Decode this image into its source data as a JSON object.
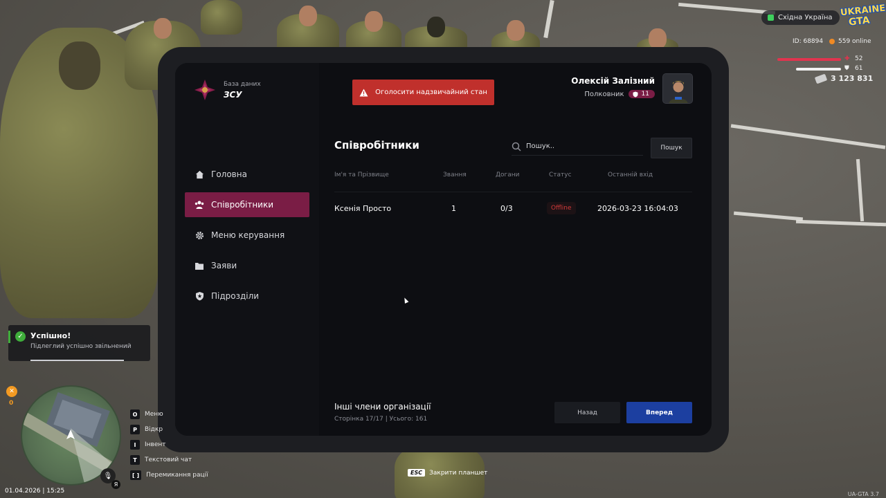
{
  "hud": {
    "region": "Східна Україна",
    "logo_line1": "UKRAINE",
    "logo_line2": "GTA",
    "player_id": "ID: 68894",
    "online": "559 online",
    "health": "52",
    "armor": "61",
    "health_level": 0.52,
    "armor_level": 0.61,
    "money": "3 123 831"
  },
  "org": {
    "subtitle": "База даних",
    "title": "ЗСУ"
  },
  "alarm_button": "Оголосити надзвичайний стан",
  "user": {
    "name": "Олексій Залізний",
    "rank": "Полковник",
    "rank_level": "11"
  },
  "sidebar": {
    "items": [
      {
        "label": "Головна",
        "icon": "home-icon"
      },
      {
        "label": "Співробітники",
        "icon": "people-icon",
        "active": true
      },
      {
        "label": "Меню керування",
        "icon": "gear-icon"
      },
      {
        "label": "Заяви",
        "icon": "folder-icon"
      },
      {
        "label": "Підрозділи",
        "icon": "shield-icon"
      }
    ]
  },
  "content": {
    "title": "Співробітники",
    "search_placeholder": "Пошук..",
    "search_button": "Пошук",
    "columns": [
      "Ім'я та Прізвище",
      "Звання",
      "Догани",
      "Статус",
      "Останній вхід"
    ],
    "rows": [
      {
        "name": "Ксенія Просто",
        "rank": "1",
        "reprimands": "0/3",
        "status": "Offline",
        "last_login": "2026-03-23 16:04:03"
      }
    ],
    "footer_title": "Інші члени організації",
    "footer_sub": "Сторінка 17/17 | Усього: 161",
    "back_button": "Назад",
    "next_button": "Вперед"
  },
  "toast": {
    "title": "Успішно!",
    "text": "Підлеглий успішно звільнений"
  },
  "hunger_value": "0",
  "mic_lang": "Я",
  "datetime": "01.04.2026 | 15:25",
  "keybinds": [
    {
      "key": "O",
      "label": "Меню"
    },
    {
      "key": "P",
      "label": "Відкр"
    },
    {
      "key": "I",
      "label": "Інвент"
    },
    {
      "key": "T",
      "label": "Текстовий чат"
    },
    {
      "key": "[ ]",
      "label": "Перемикання рації"
    }
  ],
  "esc_hint": {
    "key": "ESC",
    "label": "Закрити планшет"
  },
  "version": "UA-GTA 3.7",
  "colors": {
    "accent": "#7a1d45",
    "alarm": "#c0302c",
    "primary": "#1c3fa0",
    "offline": "#d33a3a",
    "success": "#3fae3b"
  }
}
